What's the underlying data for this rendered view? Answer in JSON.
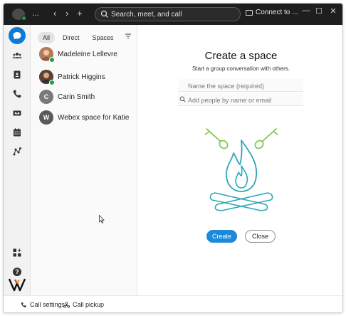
{
  "titlebar": {
    "ellipsis": "...",
    "back": "‹",
    "forward": "›",
    "add": "+",
    "search_placeholder": "Search, meet, and call",
    "connect_label": "Connect to ...",
    "minimize": "—",
    "maximize": "☐",
    "close": "✕"
  },
  "rail": {
    "items": [
      "messaging-icon",
      "teams-icon",
      "contacts-icon",
      "calling-icon",
      "voicemail-icon",
      "calendar-icon",
      "workflow-icon"
    ],
    "bottom": [
      "apps-icon",
      "help-icon"
    ]
  },
  "list": {
    "filters": [
      "All",
      "Direct",
      "Spaces"
    ],
    "items": [
      {
        "label": "Madeleine Lellevre",
        "initial": "",
        "color": "#c88b6a",
        "online": true
      },
      {
        "label": "Patrick Higgins",
        "initial": "",
        "color": "#6b4a3a",
        "online": true
      },
      {
        "label": "Carin Smith",
        "initial": "C",
        "color": "#7a7a7a",
        "online": false
      },
      {
        "label": "Webex space for Katie",
        "initial": "W",
        "color": "#5a5a5a",
        "online": false
      }
    ]
  },
  "main": {
    "title": "Create a space",
    "subtitle": "Start a group conversation with others.",
    "name_placeholder": "Name the space (required)",
    "people_placeholder": "Add people by name or email",
    "create_label": "Create",
    "close_label": "Close"
  },
  "bottombar": {
    "call_settings": "Call settings",
    "call_pickup": "Call pickup"
  },
  "colors": {
    "accent": "#1a8ad9",
    "illustration_green": "#7cc24a",
    "illustration_teal": "#2aa7b8"
  }
}
